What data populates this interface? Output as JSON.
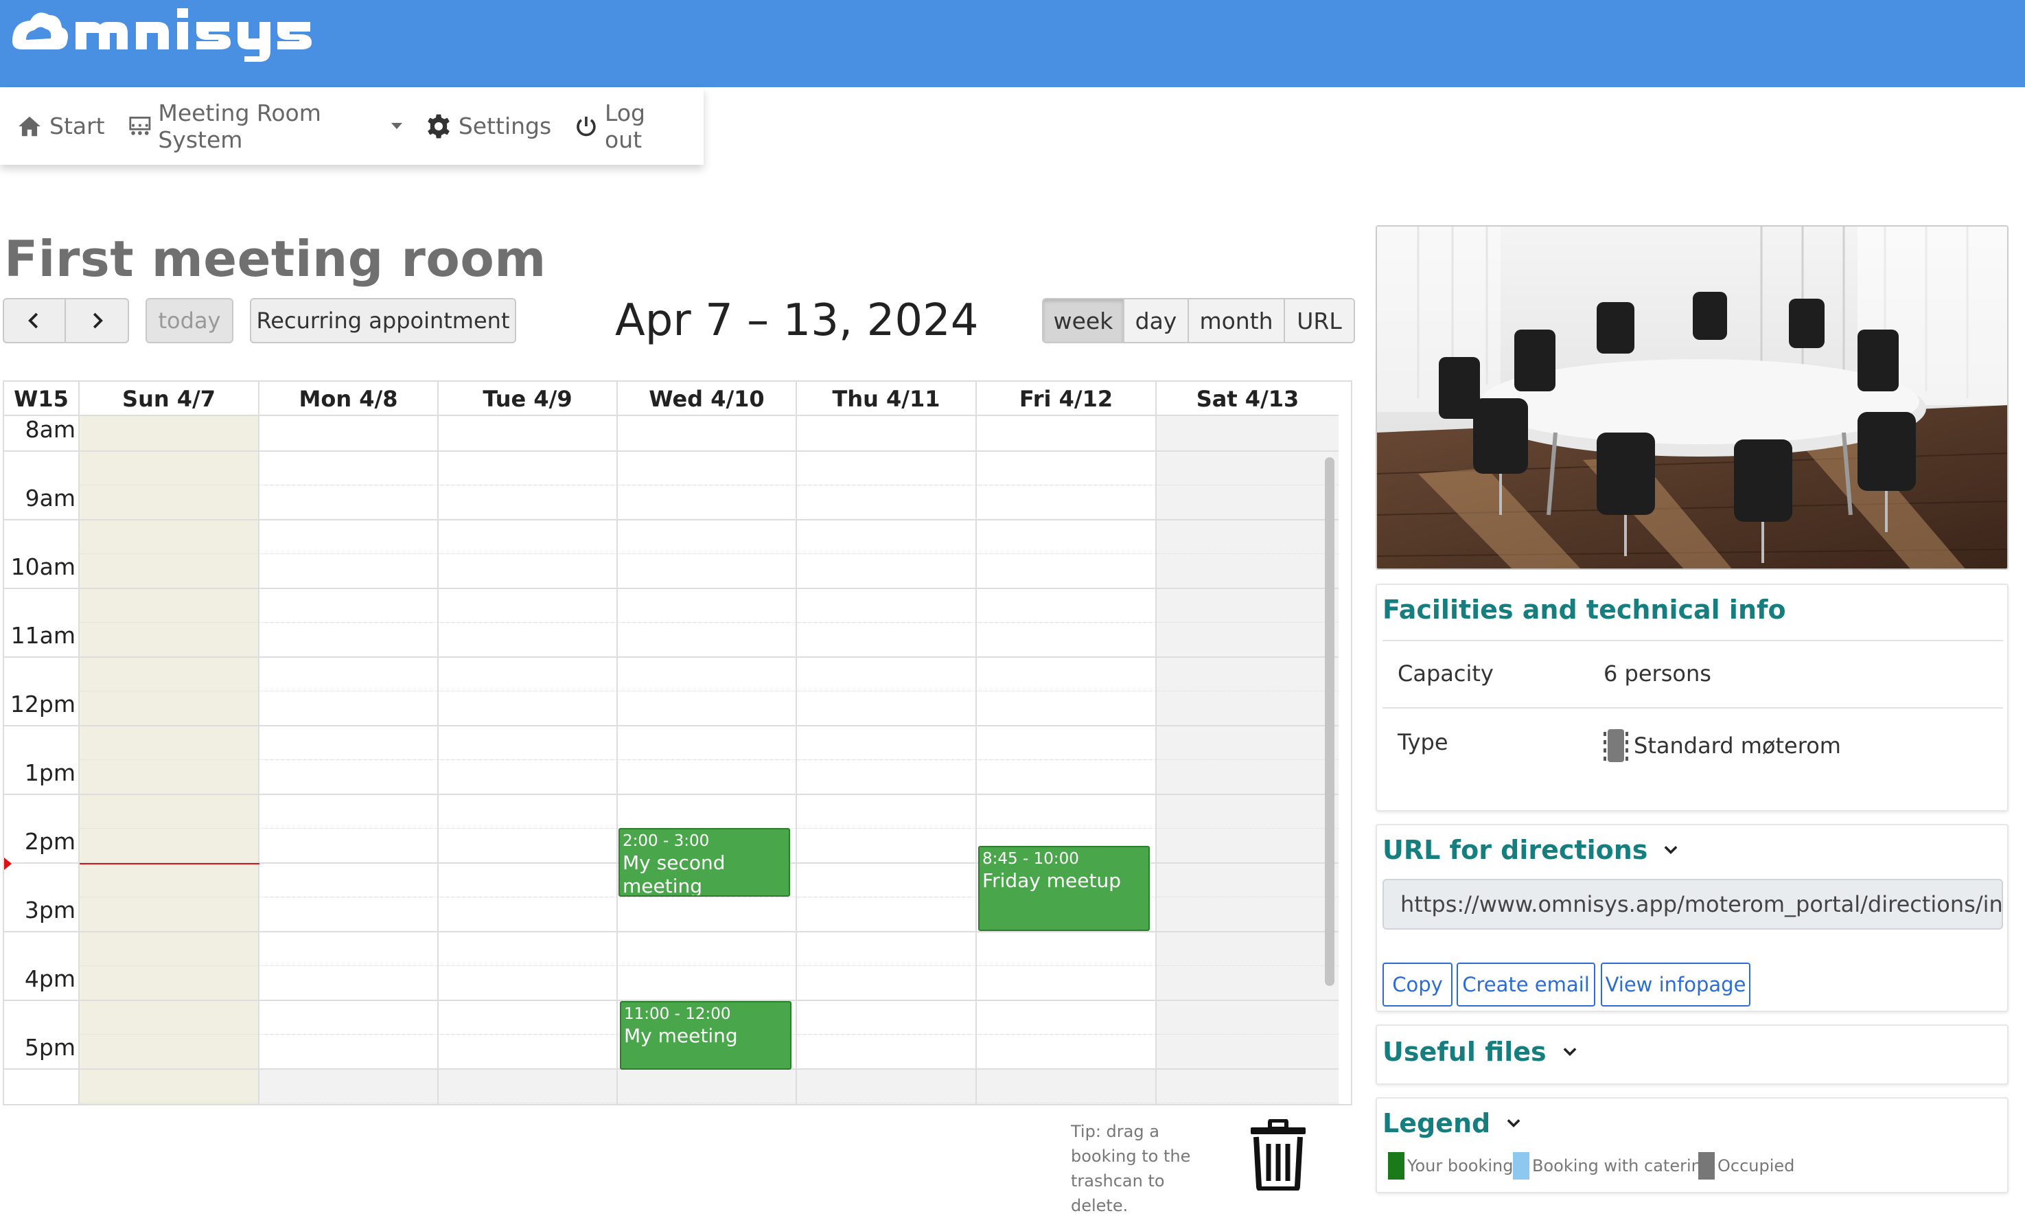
{
  "brand": {
    "name": "omnisys",
    "bar_color": "#4a90e2"
  },
  "nav": {
    "items": [
      {
        "label": "Start",
        "icon": "home-icon"
      },
      {
        "label": "Meeting Room System",
        "icon": "meeting-room-icon"
      },
      {
        "label": "Settings",
        "icon": "gear-icon"
      },
      {
        "label": "Log out",
        "icon": "power-icon"
      }
    ]
  },
  "room": {
    "title": "First meeting room"
  },
  "toolbar": {
    "prev_label": "‹",
    "next_label": "›",
    "today_label": "today",
    "recurring_label": "Recurring appointment",
    "date_range": "Apr 7 – 13, 2024",
    "views": [
      "week",
      "day",
      "month",
      "URL"
    ],
    "active_view": "week"
  },
  "calendar": {
    "week_label": "W15",
    "days": [
      "Sun 4/7",
      "Mon 4/8",
      "Tue 4/9",
      "Wed 4/10",
      "Thu 4/11",
      "Fri 4/12",
      "Sat 4/13"
    ],
    "hours": [
      "8am",
      "9am",
      "10am",
      "11am",
      "12pm",
      "1pm",
      "2pm",
      "3pm",
      "4pm",
      "5pm"
    ],
    "today_color": "#f1efe1",
    "weekend_color": "#f2f2f2",
    "current_time": "1:57 pm",
    "events": [
      {
        "time": "8:45 - 10:00",
        "title": "Friday meetup"
      },
      {
        "time": "11:00 - 12:00",
        "title": "My meeting"
      },
      {
        "time": "2:00 - 3:00",
        "title": "My second meeting"
      }
    ],
    "event_color": "#4aa64a"
  },
  "trash": {
    "tip": "Tip: drag a booking to the trashcan to delete."
  },
  "facilities": {
    "title": "Facilities and technical info",
    "rows": [
      {
        "label": "Capacity",
        "value": "6 persons"
      },
      {
        "label": "Type",
        "value": "Standard møterom"
      }
    ]
  },
  "directions": {
    "title": "URL for directions",
    "url": "https://www.omnisys.app/moterom_portal/directions/ind",
    "copy_label": "Copy",
    "email_label": "Create email",
    "infopage_label": "View infopage"
  },
  "useful_files": {
    "title": "Useful files"
  },
  "legend": {
    "title": "Legend",
    "items": [
      {
        "label": "Your booking",
        "color": "#1a7a1a"
      },
      {
        "label": "Booking with catering",
        "color": "#8ec8f0"
      },
      {
        "label": "Occupied",
        "color": "#777777"
      }
    ]
  },
  "accent_color": "#167e7e"
}
